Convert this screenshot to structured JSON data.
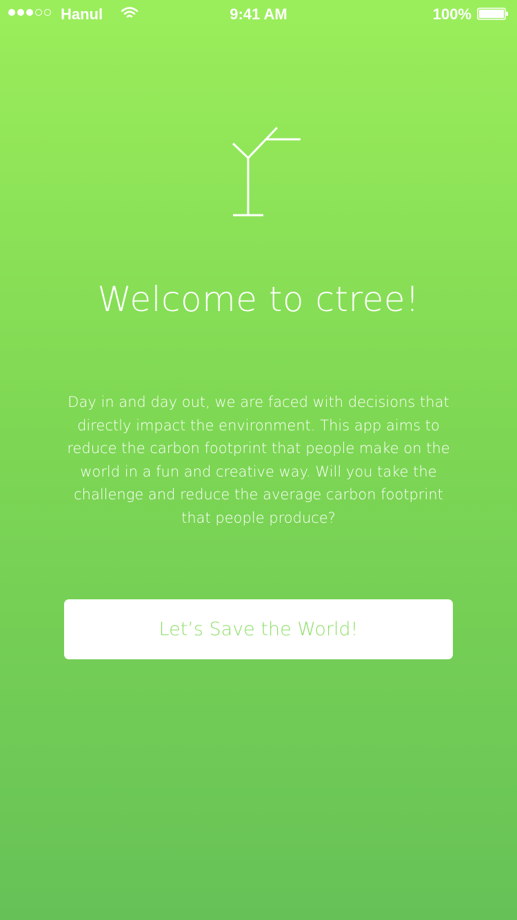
{
  "status_bar": {
    "carrier": "Hanul",
    "time": "9:41 AM",
    "battery_percent": "100%",
    "signal_bars_filled": 3,
    "signal_bars_total": 5,
    "icons": [
      "signal-dots-icon",
      "wifi-icon",
      "battery-icon"
    ]
  },
  "logo": {
    "icon": "tree-logo-icon"
  },
  "welcome": {
    "title": "Welcome to ctree!",
    "description": "Day in and day out, we are faced with decisions that directly impact the environment. This app aims to reduce the carbon footprint that people make on the world in a fun and creative way. Will you take the challenge and reduce the average carbon footprint that people produce?"
  },
  "cta": {
    "label": "Let’s Save the World!"
  },
  "colors": {
    "gradient_top": "#9bee5b",
    "gradient_bottom": "#66c257",
    "button_bg": "#ffffff",
    "button_text": "#8fdf69",
    "text": "#ffffff"
  }
}
